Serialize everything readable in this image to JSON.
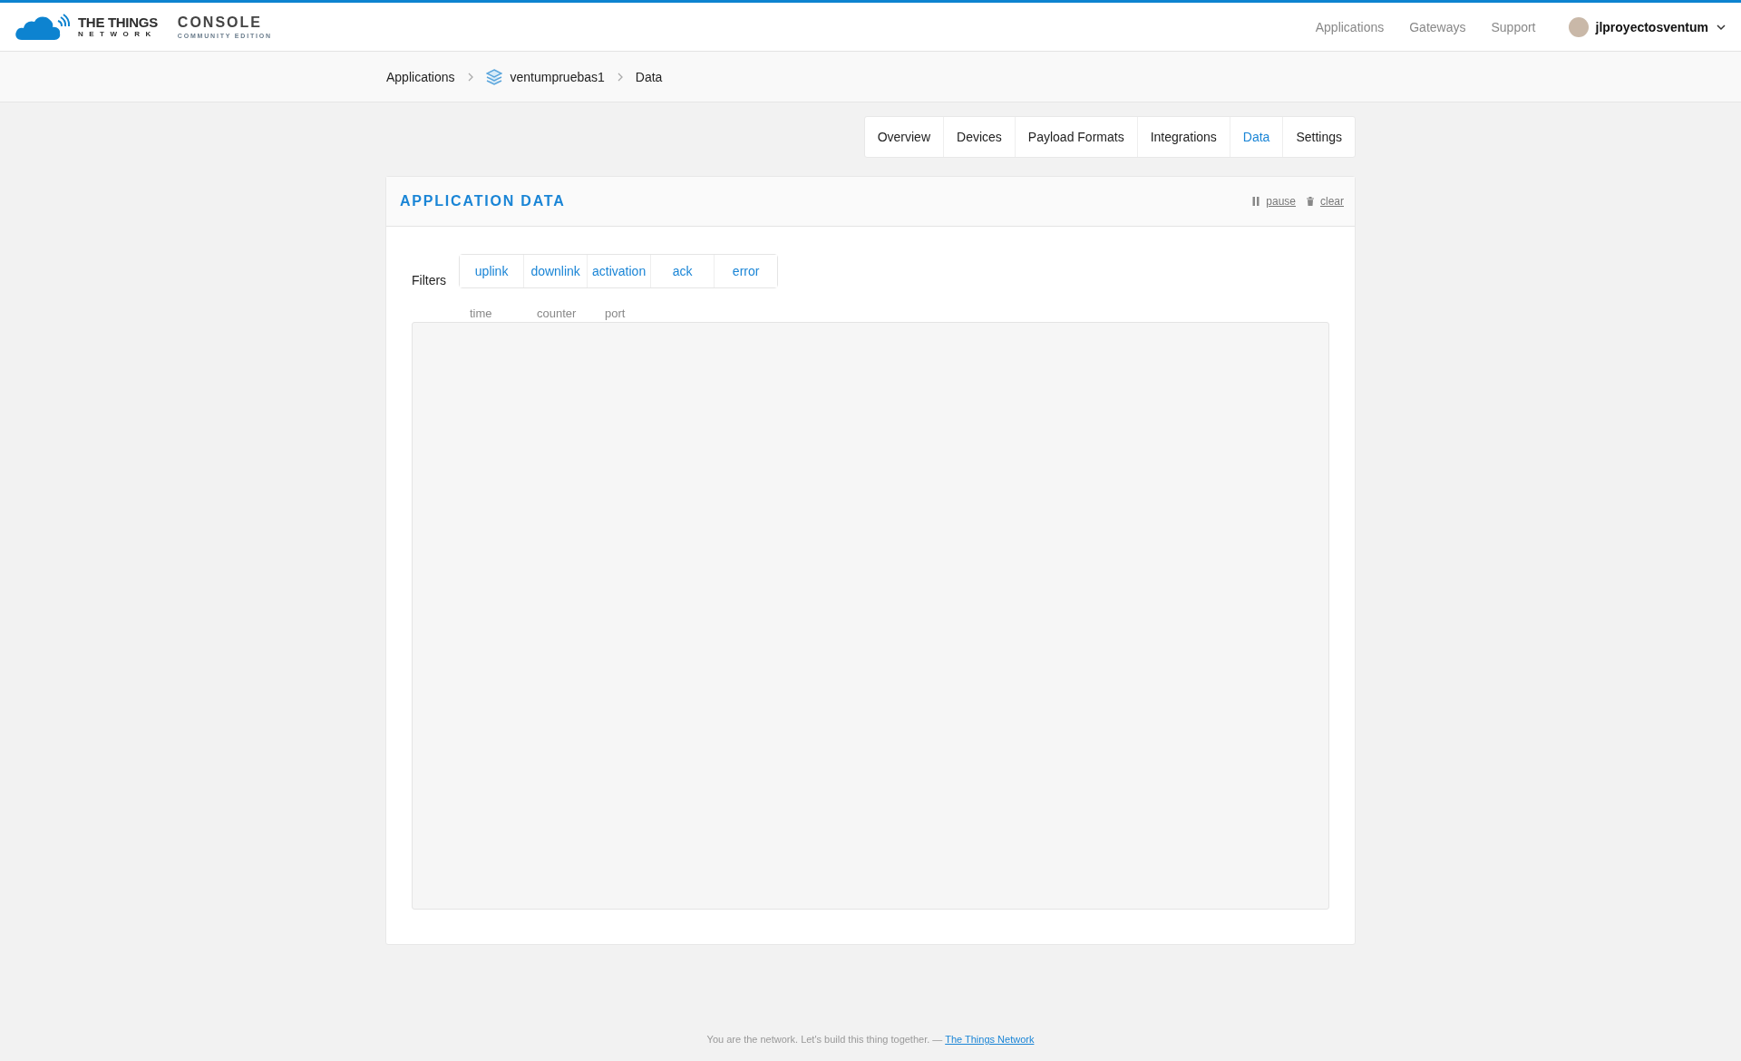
{
  "header": {
    "logo": {
      "brand_top": "THE THINGS",
      "brand_bottom": "NETWORK",
      "product": "CONSOLE",
      "edition": "COMMUNITY EDITION"
    },
    "nav": [
      "Applications",
      "Gateways",
      "Support"
    ],
    "user": {
      "name": "jlproyectosventum"
    }
  },
  "breadcrumbs": [
    {
      "label": "Applications",
      "kind": "link"
    },
    {
      "label": "ventumpruebas1",
      "kind": "app"
    },
    {
      "label": "Data",
      "kind": "current"
    }
  ],
  "tabs": [
    {
      "label": "Overview",
      "selected": false
    },
    {
      "label": "Devices",
      "selected": false
    },
    {
      "label": "Payload Formats",
      "selected": false
    },
    {
      "label": "Integrations",
      "selected": false
    },
    {
      "label": "Data",
      "selected": true
    },
    {
      "label": "Settings",
      "selected": false
    }
  ],
  "card": {
    "title": "APPLICATION DATA",
    "actions": [
      {
        "label": "pause",
        "kind": "pause"
      },
      {
        "label": "clear",
        "kind": "clear"
      }
    ],
    "filters_label": "Filters",
    "filters": [
      "uplink",
      "downlink",
      "activation",
      "ack",
      "error"
    ],
    "columns": [
      "time",
      "counter",
      "port"
    ]
  },
  "footer": {
    "text": "You are the network. Let's build this thing together. —",
    "link": "The Things Network"
  }
}
